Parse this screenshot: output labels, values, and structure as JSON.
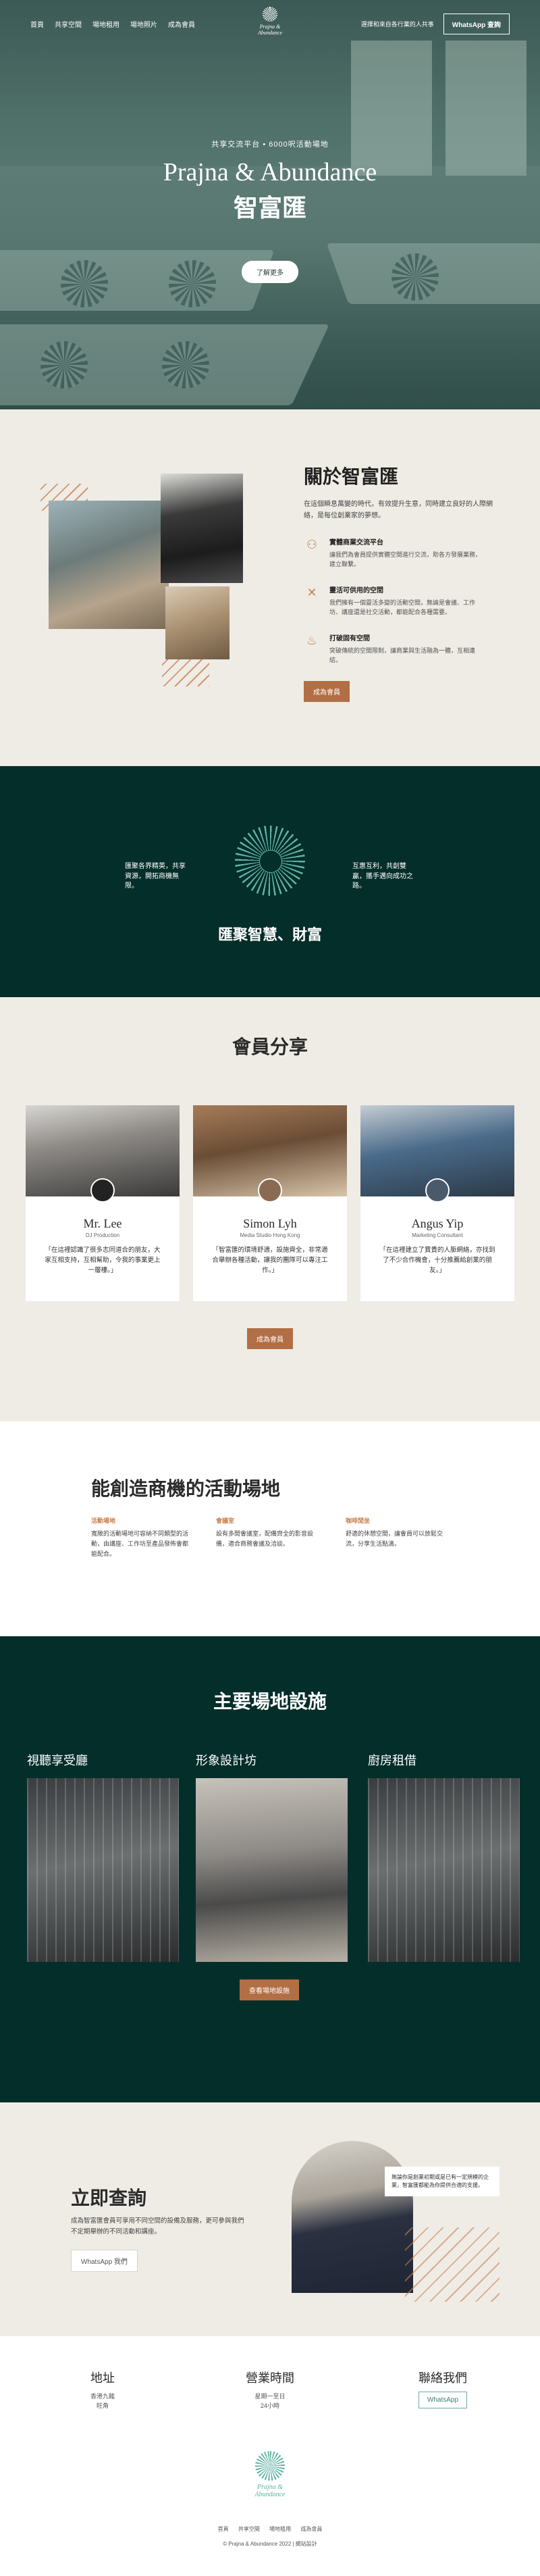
{
  "nav": {
    "links": [
      "首頁",
      "共享空間",
      "場地租用",
      "場地照片",
      "成為會員"
    ],
    "brand": "Prajna & Abundance",
    "tagline": "選擇和來自各行業的人共事",
    "whatsapp_label": "WhatsApp 查詢"
  },
  "hero": {
    "tag": "共享交流平台 • 6000呎活動場地",
    "title_en": "Prajna & Abundance",
    "title_zh": "智富匯",
    "cta": "了解更多"
  },
  "about": {
    "heading": "關於智富匯",
    "intro": "在這個瞬息萬變的時代，有效提升生意，同時建立良好的人際網絡，是每位創業家的夢想。",
    "features": [
      {
        "icon": "people-icon",
        "title": "實體商業交流平台",
        "desc": "讓我們為會員提供實體空間進行交流，助各方發展業務，建立聯繫。"
      },
      {
        "icon": "tools-icon",
        "title": "靈活可供用的空間",
        "desc": "我們擁有一個靈活多變的活動空間，無論是會議、工作坊、講座還是社交活動，都能配合各種需要。"
      },
      {
        "icon": "water-icon",
        "title": "打破固有空間",
        "desc": "突破傳統的空間限制，讓商業與生活融為一體，互相連結。"
      }
    ],
    "button": "成為會員"
  },
  "band": {
    "left_quote": "匯聚各界精英，共享資源，開拓商機無限。",
    "right_quote": "互惠互利，共創雙贏，攜手邁向成功之路。",
    "slogan": "匯聚智慧、財富"
  },
  "members": {
    "heading": "會員分享",
    "cards": [
      {
        "name": "Mr. Lee",
        "role": "DJ Production",
        "quote": "「在這裡認識了很多志同道合的朋友，大家互相支持，互相幫助，令我的事業更上一層樓。」"
      },
      {
        "name": "Simon Lyh",
        "role": "Media Studio Hong Kong",
        "quote": "「智富匯的環境舒適，設施齊全，非常適合舉辦各種活動，讓我的團隊可以專注工作。」"
      },
      {
        "name": "Angus Yip",
        "role": "Marketing Consultant",
        "quote": "「在這裡建立了寶貴的人脈網絡，亦找到了不少合作機會，十分推薦給創業的朋友。」"
      }
    ],
    "button": "成為會員"
  },
  "venue": {
    "heading": "能創造商機的活動場地",
    "cols": [
      {
        "title": "活動場地",
        "desc": "寬敞的活動場地可容納不同類型的活動，由講座、工作坊至產品發佈會都能配合。"
      },
      {
        "title": "會議室",
        "desc": "設有多間會議室，配備齊全的影音設備，適合商務會議及洽談。"
      },
      {
        "title": "咖啡閒坐",
        "desc": "舒適的休憩空間，讓會員可以放鬆交流，分享生活點滴。"
      }
    ]
  },
  "facilities": {
    "heading": "主要場地設施",
    "items": [
      "視聽享受廳",
      "形象設計坊",
      "廚房租借"
    ],
    "button": "查看場地設施"
  },
  "contact": {
    "heading": "立即查詢",
    "desc": "成為智富匯會員可享用不同空間的設備及服務，更可參與我們不定期舉辦的不同活動和講座。",
    "whatsapp": "WhatsApp 我們",
    "speech": "無論你是創業初期或是已有一定規模的企業，智富匯都能為你提供合適的支援。"
  },
  "footer": {
    "address_h": "地址",
    "address": [
      "香港九龍",
      "旺角"
    ],
    "hours_h": "營業時間",
    "hours": [
      "星期一至日",
      "24小時"
    ],
    "contact_h": "聯絡我們",
    "whatsapp": "WhatsApp",
    "brand": "Prajna & Abundance",
    "links": [
      "首頁",
      "共享空間",
      "場地租用",
      "成為會員"
    ],
    "copyright": "© Prajna & Abundance 2022  |  網站設計"
  }
}
